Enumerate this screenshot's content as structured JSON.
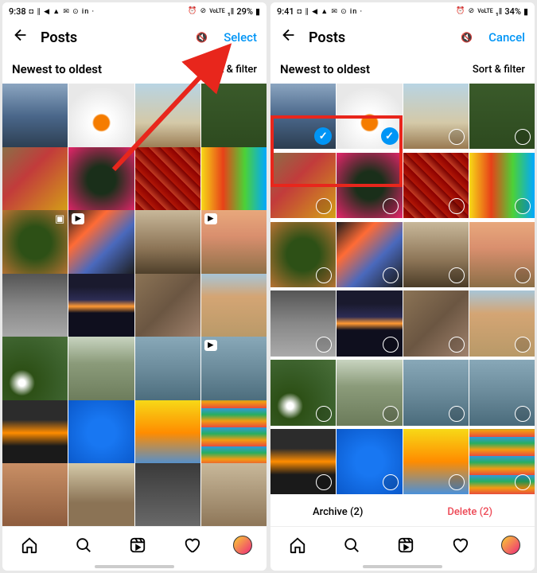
{
  "left": {
    "status": {
      "time": "9:38",
      "icons_l": "◘ ∥ ◀ ▲ ✉ ⊙ in ·",
      "icons_r": "⏰ ⊘",
      "net": "VoLTE",
      "signal": "₁‖",
      "battery": "29%"
    },
    "appbar": {
      "title": "Posts",
      "action": "Select"
    },
    "filter": {
      "sort": "Newest to oldest",
      "filter": "Sort & filter"
    }
  },
  "right": {
    "status": {
      "time": "9:41",
      "icons_l": "◘ ∥ ◀ ▲ ✉ ⊙ in ·",
      "icons_r": "⏰ ⊘",
      "net": "VoLTE",
      "signal": "₁‖",
      "battery": "34%"
    },
    "appbar": {
      "title": "Posts",
      "action": "Cancel"
    },
    "filter": {
      "sort": "Newest to oldest",
      "filter": "Sort & filter"
    },
    "actions": {
      "archive": "Archive (2)",
      "delete": "Delete (2)"
    }
  },
  "annotations": {
    "arrow_target": "Select button",
    "red_box_target": "Two selected thumbnails with blue checkmarks"
  }
}
